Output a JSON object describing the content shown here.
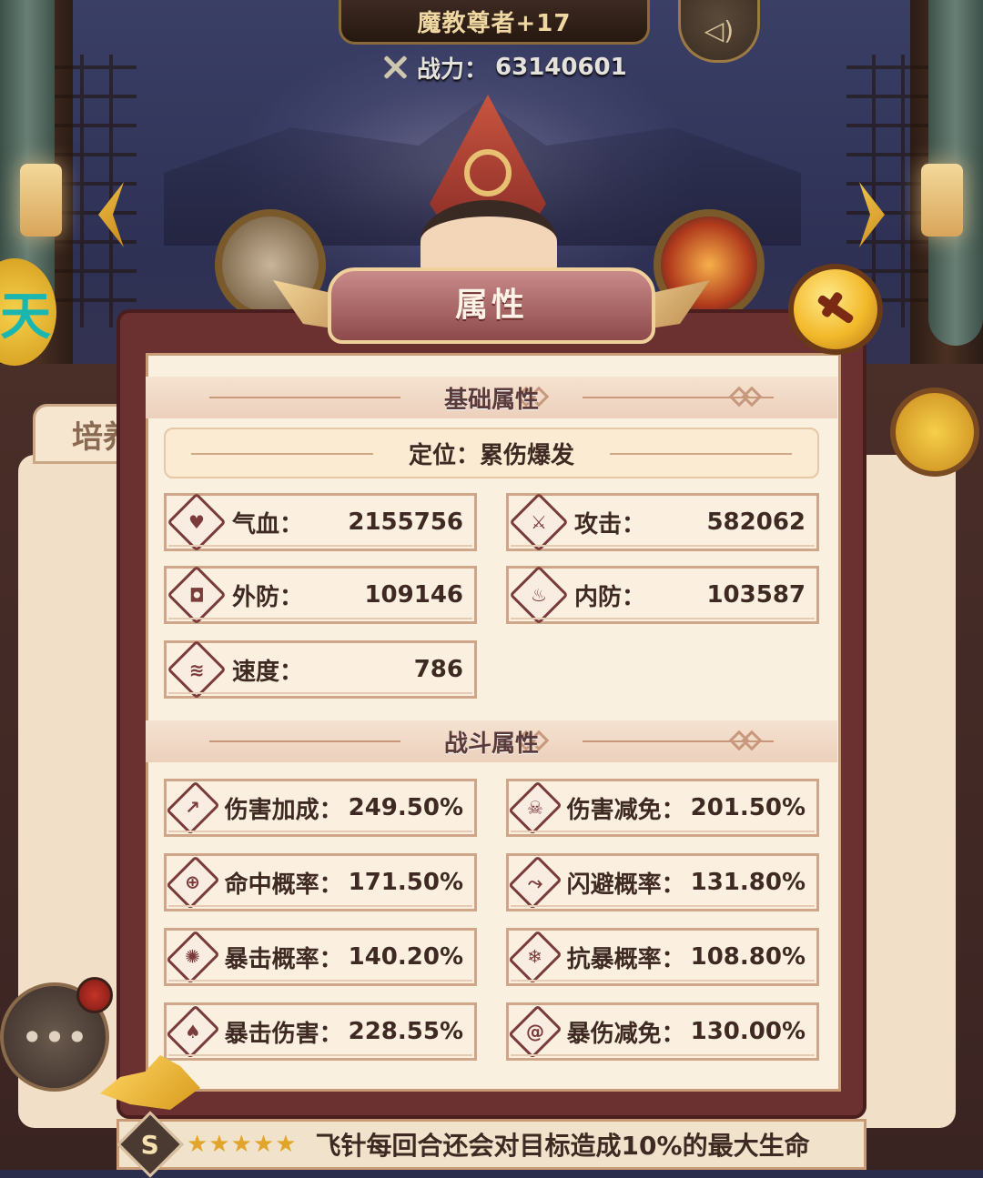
{
  "header": {
    "hero_name": "魔教尊者+17",
    "power_label": "战力：",
    "power_value": "63140601"
  },
  "background": {
    "side_badge_glyph": "天",
    "tab_label": "培养"
  },
  "panel": {
    "title": "属性",
    "sections": {
      "basic_title": "基础属性",
      "battle_title": "战斗属性"
    },
    "position_text": "定位：累伤爆发",
    "basic_stats": [
      {
        "label": "气血：",
        "value": "2155756",
        "icon": "heart-icon"
      },
      {
        "label": "攻击：",
        "value": "582062",
        "icon": "sword-icon"
      },
      {
        "label": "外防：",
        "value": "109146",
        "icon": "shield-icon"
      },
      {
        "label": "内防：",
        "value": "103587",
        "icon": "flame-shield-icon"
      },
      {
        "label": "速度：",
        "value": "786",
        "icon": "wind-icon"
      }
    ],
    "battle_stats": [
      {
        "label": "伤害加成：",
        "value": "249.50%",
        "icon": "damage-up-icon"
      },
      {
        "label": "伤害减免：",
        "value": "201.50%",
        "icon": "skull-icon"
      },
      {
        "label": "命中概率：",
        "value": "171.50%",
        "icon": "crosshair-icon"
      },
      {
        "label": "闪避概率：",
        "value": "131.80%",
        "icon": "dodge-icon"
      },
      {
        "label": "暴击概率：",
        "value": "140.20%",
        "icon": "crit-flame-icon"
      },
      {
        "label": "抗暴概率：",
        "value": "108.80%",
        "icon": "snowflake-icon"
      },
      {
        "label": "暴击伤害：",
        "value": "228.55%",
        "icon": "fire-icon"
      },
      {
        "label": "暴伤减免：",
        "value": "130.00%",
        "icon": "swirl-icon"
      }
    ]
  },
  "skill": {
    "grade": "S",
    "stars": "★★★★★",
    "text": "飞针每回合还会对目标造成10%的最大生命"
  },
  "colors": {
    "panel_frame": "#6b3030",
    "panel_bg": "#faf0df",
    "text_main": "#3e2a22",
    "gold": "#f2b92a"
  }
}
